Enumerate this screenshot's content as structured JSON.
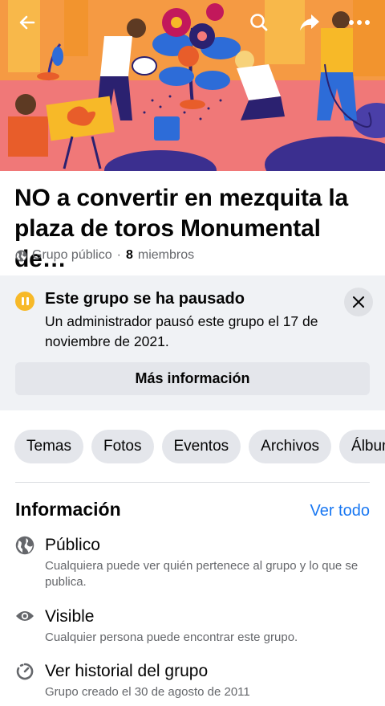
{
  "cover": {
    "alt": "community-garden-illustration",
    "colors": {
      "sky": "#f07878",
      "ground": "#f07878",
      "accent_yellow": "#f7b928",
      "plant_blue": "#2d6cd8"
    }
  },
  "top_bar": {
    "back_icon": "back-arrow-icon",
    "search_icon": "search-icon",
    "share_icon": "share-icon",
    "more_icon": "more-dots-icon"
  },
  "group": {
    "title": "NO a convertir en mezquita la plaza de toros Monumental de…",
    "privacy_label": "Grupo público",
    "separator": "·",
    "member_count": "8",
    "member_label": "miembros"
  },
  "paused_notice": {
    "title": "Este grupo se ha pausado",
    "description": "Un administrador pausó este grupo el 17 de noviembre de 2021.",
    "button_label": "Más información",
    "accent_color": "#f7b928"
  },
  "tabs": [
    {
      "label": "Temas"
    },
    {
      "label": "Fotos"
    },
    {
      "label": "Eventos"
    },
    {
      "label": "Archivos"
    },
    {
      "label": "Álbumes"
    }
  ],
  "info": {
    "heading": "Información",
    "see_all_label": "Ver todo",
    "link_color": "#1877f2",
    "items": [
      {
        "icon": "globe-icon",
        "title": "Público",
        "description": "Cualquiera puede ver quién pertenece al grupo y lo que se publica."
      },
      {
        "icon": "eye-icon",
        "title": "Visible",
        "description": "Cualquier persona puede encontrar este grupo."
      },
      {
        "icon": "history-icon",
        "title": "Ver historial del grupo",
        "description": "Grupo creado el 30 de agosto de 2011"
      }
    ]
  }
}
